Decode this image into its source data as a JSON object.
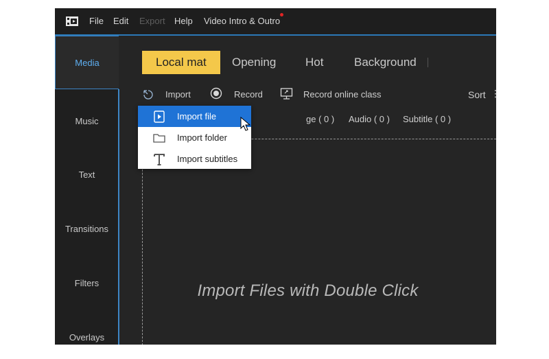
{
  "menubar": {
    "items": [
      {
        "label": "File",
        "disabled": false
      },
      {
        "label": "Edit",
        "disabled": false
      },
      {
        "label": "Export",
        "disabled": true
      },
      {
        "label": "Help",
        "disabled": false
      },
      {
        "label": "Video Intro & Outro",
        "disabled": false
      }
    ],
    "logo_icon": "film-clapper-icon"
  },
  "sidebar": {
    "items": [
      {
        "label": "Media",
        "active": true
      },
      {
        "label": "Music",
        "active": false
      },
      {
        "label": "Text",
        "active": false
      },
      {
        "label": "Transitions",
        "active": false
      },
      {
        "label": "Filters",
        "active": false
      },
      {
        "label": "Overlays",
        "active": false
      }
    ]
  },
  "tabs": [
    {
      "label": "Local mat",
      "active": true
    },
    {
      "label": "Opening",
      "active": false
    },
    {
      "label": "Hot",
      "active": false
    },
    {
      "label": "Background",
      "active": false
    }
  ],
  "toolbar": {
    "import_label": "Import",
    "record_label": "Record",
    "record_online_label": "Record online class",
    "sort_label": "Sort"
  },
  "filters": {
    "image_label": "ge ( 0 )",
    "audio_label": "Audio ( 0 )",
    "subtitle_label": "Subtitle ( 0 )"
  },
  "import_menu": {
    "items": [
      {
        "label": "Import file",
        "icon": "play-file-icon",
        "selected": true
      },
      {
        "label": "Import folder",
        "icon": "folder-icon",
        "selected": false
      },
      {
        "label": "Import subtitles",
        "icon": "text-t-icon",
        "selected": false
      }
    ]
  },
  "drop_hint": "Import Files with Double Click",
  "colors": {
    "accent_blue": "#2b79b8",
    "tab_active": "#f4c84a",
    "menu_selected": "#1f73d6"
  }
}
